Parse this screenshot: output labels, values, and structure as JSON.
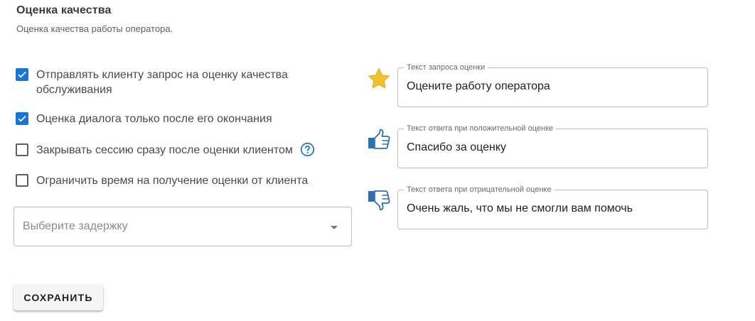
{
  "section": {
    "title": "Оценка качества",
    "subtitle": "Оценка качества работы оператора."
  },
  "options": [
    {
      "label": "Отправлять клиенту запрос на оценку качества обслуживания",
      "checked": true
    },
    {
      "label": "Оценка диалога только после его окончания",
      "checked": true
    },
    {
      "label": "Закрывать сессию сразу после оценки клиентом",
      "checked": false,
      "help_icon": "help-circle-icon"
    },
    {
      "label": "Ограничить время на получение оценки от клиента",
      "checked": false
    }
  ],
  "delay_select": {
    "placeholder": "Выберите задержку"
  },
  "fields": [
    {
      "label": "Текст запроса оценки",
      "value": "Оцените работу оператора",
      "icon": "star-icon"
    },
    {
      "label": "Текст ответа при положительной оценке",
      "value": "Спасибо за оценку",
      "icon": "thumbs-up-icon"
    },
    {
      "label": "Текст ответа при отрицательной оценке",
      "value": "Очень жаль, что мы не смогли вам помочь",
      "icon": "thumbs-down-icon"
    }
  ],
  "save_button": {
    "label": "СОХРАНИТЬ"
  },
  "colors": {
    "accent": "#1a73d9",
    "star": "#f2c12e",
    "thumb": "#2d6eb5"
  }
}
